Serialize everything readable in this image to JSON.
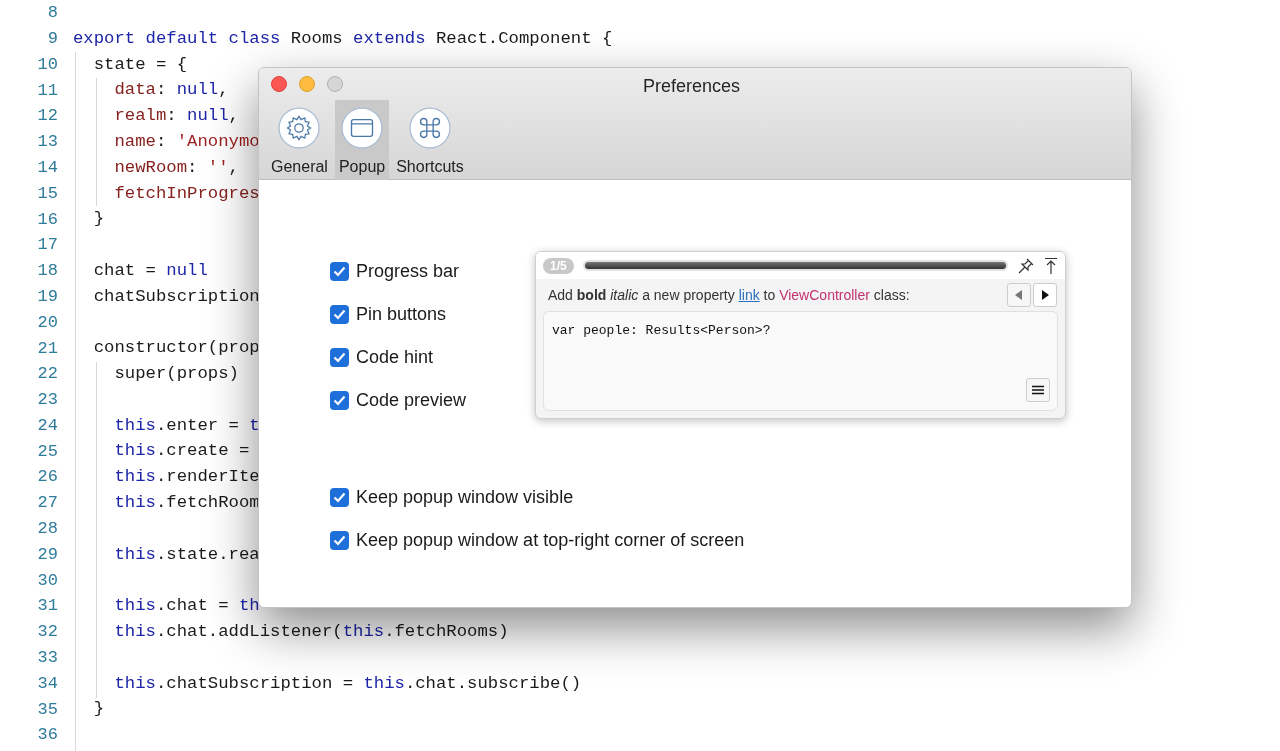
{
  "editor": {
    "lines": [
      {
        "number": "8"
      },
      {
        "number": "9",
        "tokens": [
          {
            "kind": "keyword",
            "text": "export default class"
          },
          {
            "kind": "plain",
            "text": " Rooms "
          },
          {
            "kind": "keyword",
            "text": "extends"
          },
          {
            "kind": "plain",
            "text": " React.Component {"
          }
        ]
      },
      {
        "number": "10",
        "tokens": [
          {
            "kind": "plain",
            "text": "  state = {"
          }
        ]
      },
      {
        "number": "11",
        "tokens": [
          {
            "kind": "property",
            "text": "    data"
          },
          {
            "kind": "plain",
            "text": ": "
          },
          {
            "kind": "keyword",
            "text": "null"
          },
          {
            "kind": "plain",
            "text": ","
          }
        ]
      },
      {
        "number": "12",
        "tokens": [
          {
            "kind": "property",
            "text": "    realm"
          },
          {
            "kind": "plain",
            "text": ": "
          },
          {
            "kind": "keyword",
            "text": "null"
          },
          {
            "kind": "plain",
            "text": ","
          }
        ]
      },
      {
        "number": "13",
        "tokens": [
          {
            "kind": "property",
            "text": "    name"
          },
          {
            "kind": "plain",
            "text": ": "
          },
          {
            "kind": "string",
            "text": "'Anonymo"
          }
        ]
      },
      {
        "number": "14",
        "tokens": [
          {
            "kind": "property",
            "text": "    newRoom"
          },
          {
            "kind": "plain",
            "text": ": "
          },
          {
            "kind": "string",
            "text": "''"
          },
          {
            "kind": "plain",
            "text": ","
          }
        ]
      },
      {
        "number": "15",
        "tokens": [
          {
            "kind": "property",
            "text": "    fetchInProgres"
          }
        ]
      },
      {
        "number": "16",
        "tokens": [
          {
            "kind": "plain",
            "text": "  }"
          }
        ]
      },
      {
        "number": "17"
      },
      {
        "number": "18",
        "tokens": [
          {
            "kind": "plain",
            "text": "  chat = "
          },
          {
            "kind": "keyword",
            "text": "null"
          }
        ]
      },
      {
        "number": "19",
        "tokens": [
          {
            "kind": "plain",
            "text": "  chatSubscription"
          }
        ]
      },
      {
        "number": "20"
      },
      {
        "number": "21",
        "tokens": [
          {
            "kind": "plain",
            "text": "  constructor(prop"
          }
        ]
      },
      {
        "number": "22",
        "tokens": [
          {
            "kind": "plain",
            "text": "    super(props)"
          }
        ]
      },
      {
        "number": "23"
      },
      {
        "number": "24",
        "tokens": [
          {
            "kind": "keyword",
            "text": "    this"
          },
          {
            "kind": "plain",
            "text": ".enter = "
          },
          {
            "kind": "keyword",
            "text": "t"
          }
        ]
      },
      {
        "number": "25",
        "tokens": [
          {
            "kind": "keyword",
            "text": "    this"
          },
          {
            "kind": "plain",
            "text": ".create ="
          }
        ]
      },
      {
        "number": "26",
        "tokens": [
          {
            "kind": "keyword",
            "text": "    this"
          },
          {
            "kind": "plain",
            "text": ".renderIte"
          }
        ]
      },
      {
        "number": "27",
        "tokens": [
          {
            "kind": "keyword",
            "text": "    this"
          },
          {
            "kind": "plain",
            "text": ".fetchRoom"
          }
        ]
      },
      {
        "number": "28"
      },
      {
        "number": "29",
        "tokens": [
          {
            "kind": "keyword",
            "text": "    this"
          },
          {
            "kind": "plain",
            "text": ".state.rea"
          }
        ]
      },
      {
        "number": "30"
      },
      {
        "number": "31",
        "tokens": [
          {
            "kind": "keyword",
            "text": "    this"
          },
          {
            "kind": "plain",
            "text": ".chat = "
          },
          {
            "kind": "keyword",
            "text": "th"
          }
        ]
      },
      {
        "number": "32",
        "tokens": [
          {
            "kind": "keyword",
            "text": "    this"
          },
          {
            "kind": "plain",
            "text": ".chat.addListener("
          },
          {
            "kind": "keyword",
            "text": "this"
          },
          {
            "kind": "plain",
            "text": ".fetchRooms)"
          }
        ]
      },
      {
        "number": "33"
      },
      {
        "number": "34",
        "tokens": [
          {
            "kind": "keyword",
            "text": "    this"
          },
          {
            "kind": "plain",
            "text": ".chatSubscription = "
          },
          {
            "kind": "keyword",
            "text": "this"
          },
          {
            "kind": "plain",
            "text": ".chat.subscribe()"
          }
        ]
      },
      {
        "number": "35",
        "tokens": [
          {
            "kind": "plain",
            "text": "  }"
          }
        ]
      },
      {
        "number": "36"
      }
    ]
  },
  "window": {
    "title": "Preferences",
    "tabs": [
      {
        "label": "General",
        "kind": "gear",
        "selected": false
      },
      {
        "label": "Popup",
        "kind": "window",
        "selected": true
      },
      {
        "label": "Shortcuts",
        "kind": "command",
        "selected": false
      }
    ],
    "popup_options": [
      {
        "label": "Progress bar",
        "checked": true
      },
      {
        "label": "Pin buttons",
        "checked": true
      },
      {
        "label": "Code hint",
        "checked": true
      },
      {
        "label": "Code preview",
        "checked": true
      }
    ],
    "window_options": [
      {
        "label": "Keep popup window visible",
        "checked": true
      },
      {
        "label": "Keep popup window at top-right corner of screen",
        "checked": true
      }
    ],
    "preview": {
      "counter": "1/5",
      "level": 1,
      "hint": [
        {
          "kind": "text",
          "text": "Add **bold** *italic* a new property"
        },
        {
          "kind": "link",
          "text": "link"
        },
        {
          "kind": "text",
          "text": "to"
        },
        {
          "kind": "class",
          "text": "ViewController"
        },
        {
          "kind": "text",
          "text": "class:"
        }
      ],
      "code": "var people: Results<Person>?"
    }
  }
}
